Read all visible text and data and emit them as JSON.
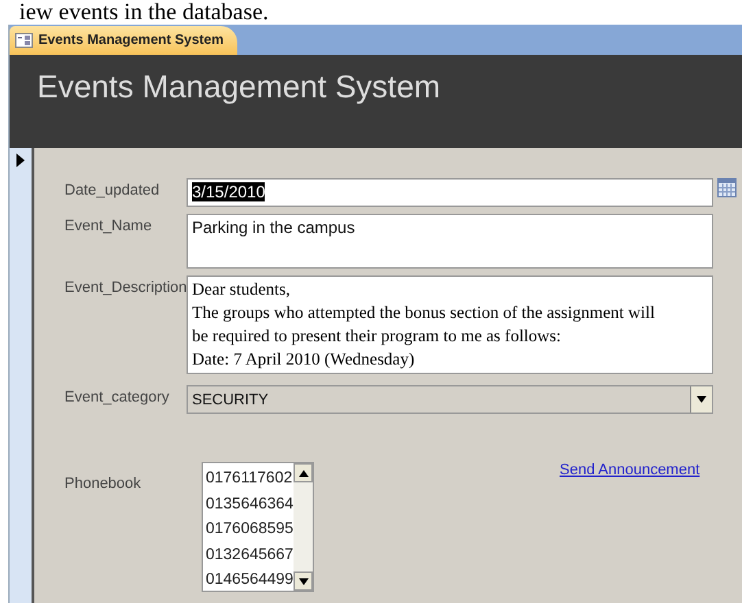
{
  "document_text": "iew events in the database.",
  "tab": {
    "label": "Events Management System",
    "selected": true
  },
  "form_title": "Events Management System",
  "record_selector": {
    "current": true
  },
  "fields": [
    {
      "kind": "date",
      "label": "Date_updated",
      "value": "3/15/2010",
      "selected_text": true
    },
    {
      "kind": "text",
      "label": "Event_Name",
      "value": "Parking in the campus"
    },
    {
      "kind": "memo",
      "label": "Event_Description",
      "lines": [
        "Dear students,",
        "The groups who attempted the bonus section of the assignment will",
        "be required to present their program to me as follows:",
        "Date: 7 April 2010 (Wednesday)"
      ]
    },
    {
      "kind": "combo",
      "label": "Event_category",
      "value": "SECURITY"
    }
  ],
  "phonebook": {
    "label": "Phonebook",
    "items": [
      "0176117602",
      "0135646364",
      "0176068595",
      "0132645667",
      "0146564499"
    ]
  },
  "link": "Send Announcement"
}
